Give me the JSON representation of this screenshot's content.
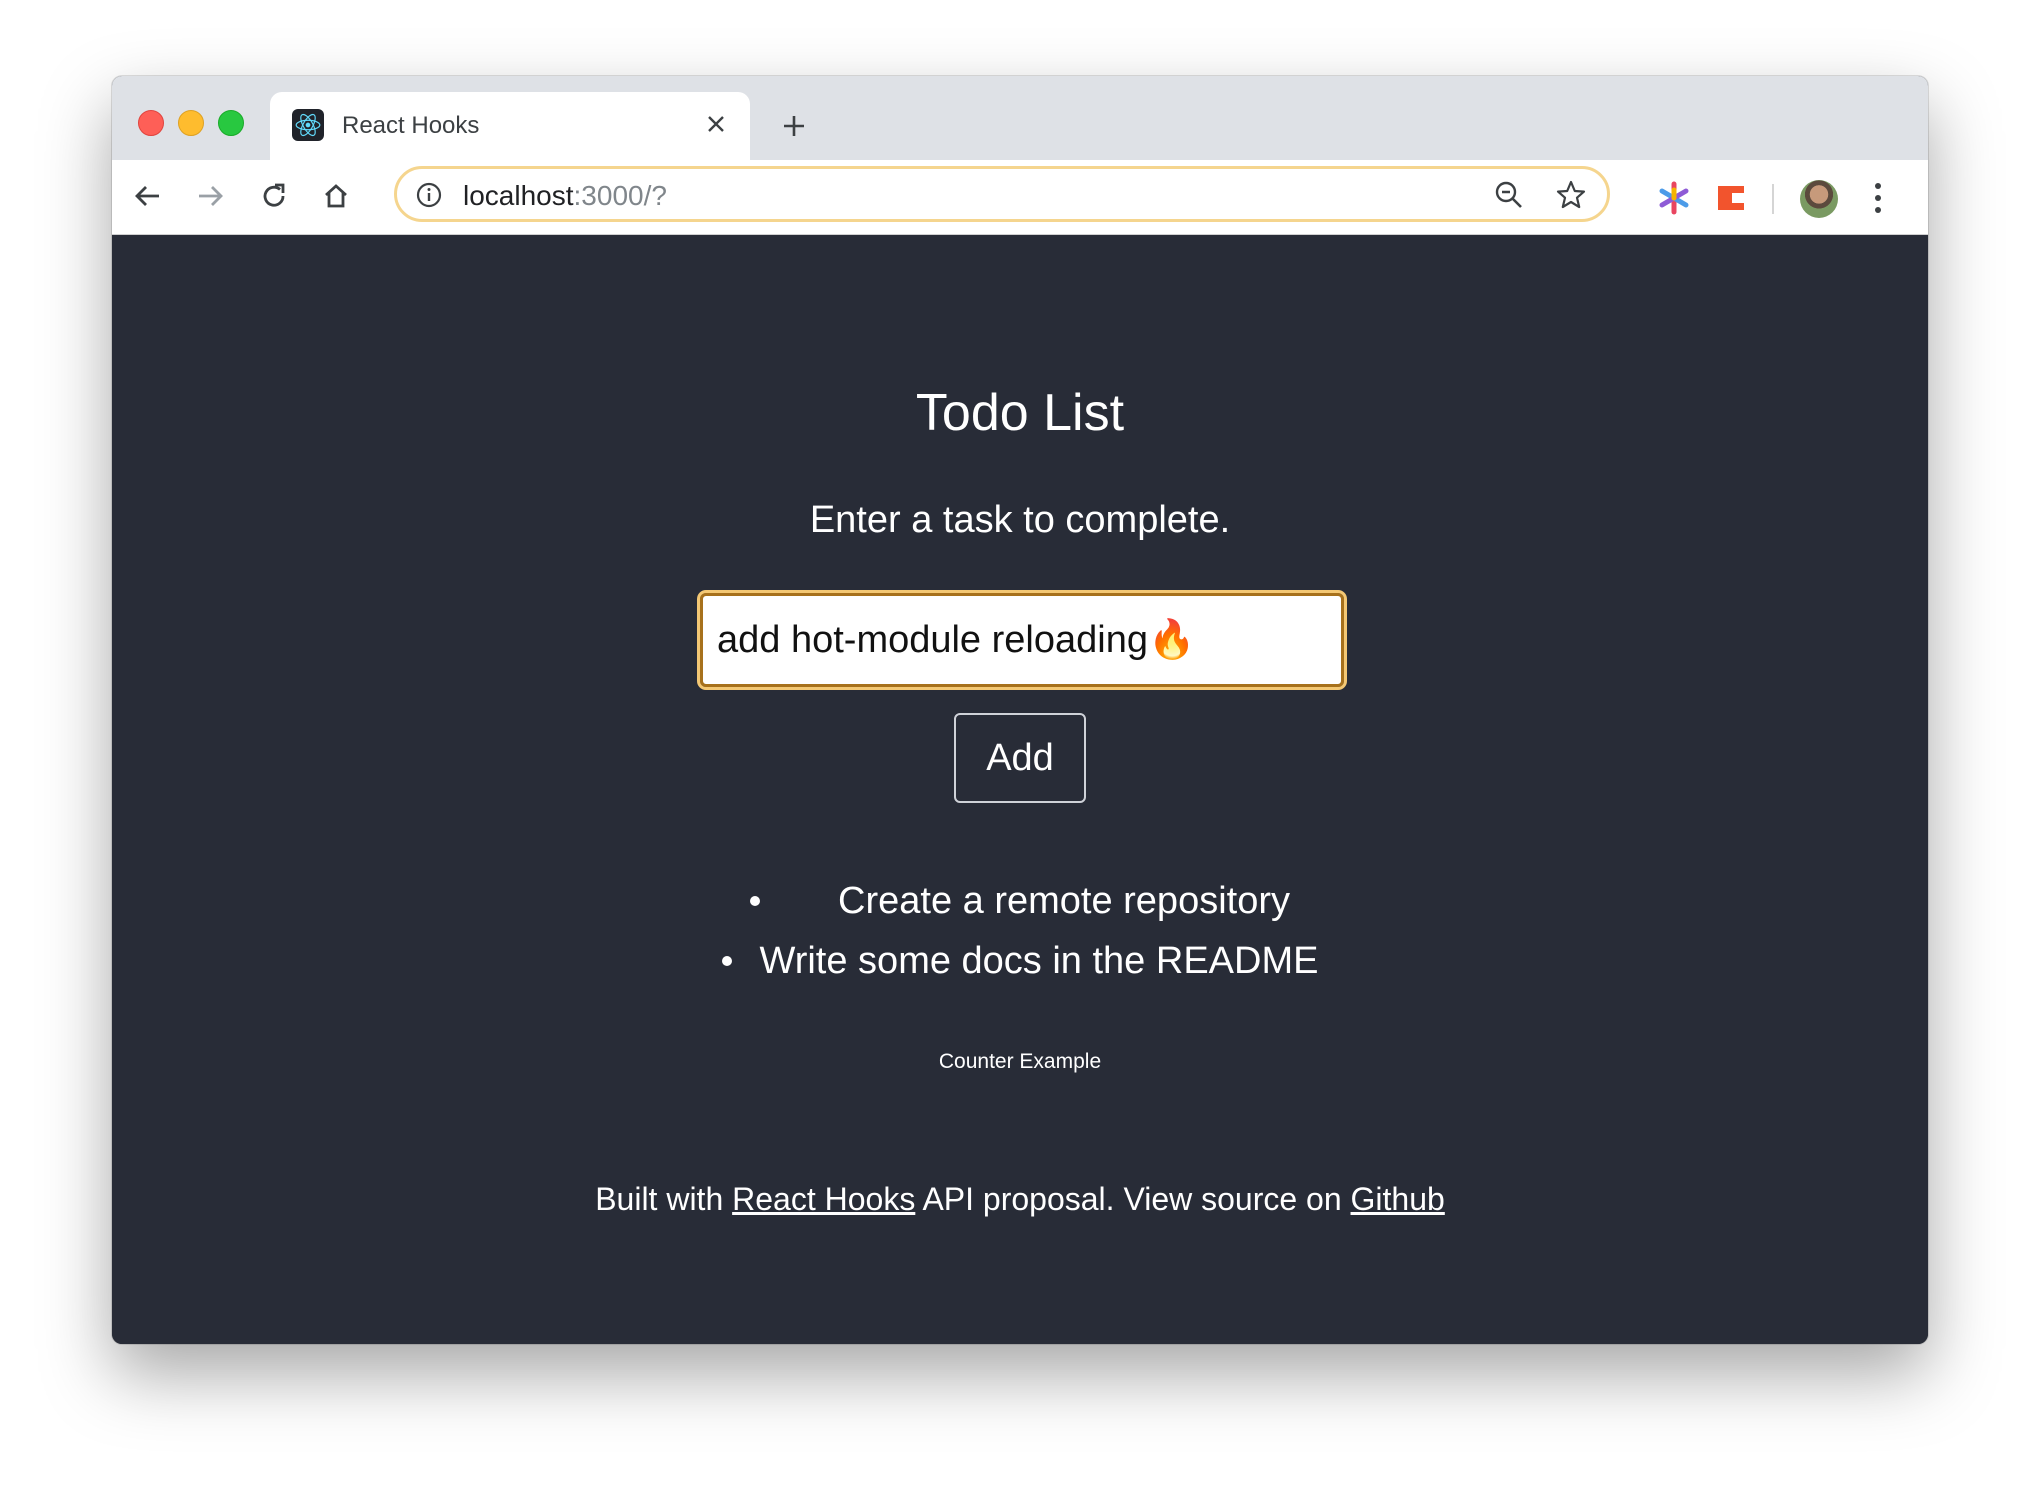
{
  "browser": {
    "tab": {
      "title": "React Hooks"
    },
    "address_bar": {
      "host": "localhost",
      "path": ":3000/?"
    },
    "icons": {
      "back": "back-arrow-icon",
      "forward": "forward-arrow-icon",
      "reload": "reload-icon",
      "home": "home-icon",
      "info": "info-icon",
      "zoom": "zoom-out-icon",
      "bookmark": "star-icon",
      "menu": "more-vert-icon"
    }
  },
  "page": {
    "title": "Todo List",
    "prompt": "Enter a task to complete.",
    "input_value": "add hot-module reloading🔥",
    "add_button": "Add",
    "todos": [
      "Create a remote repository",
      "Write some docs in the README"
    ],
    "counter_link": "Counter Example",
    "footer": {
      "prefix": "Built with ",
      "react_hooks_link": "React Hooks",
      "middle": " API proposal. View source on ",
      "github_link": "Github"
    }
  },
  "colors": {
    "page_background": "#282c37",
    "input_focus_border": "#a7711c",
    "omnibox_focus": "#f5d58e"
  }
}
